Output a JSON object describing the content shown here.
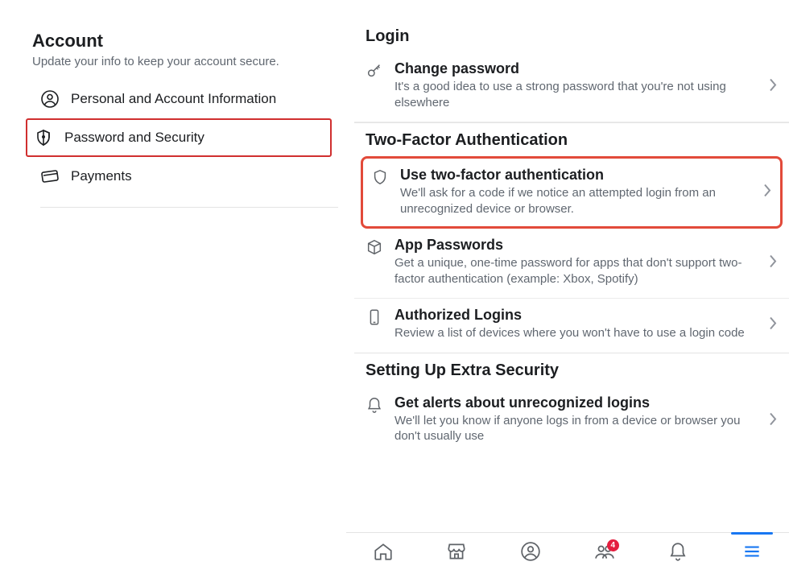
{
  "left": {
    "heading": "Account",
    "subtitle": "Update your info to keep your account secure.",
    "items": [
      {
        "label": "Personal and Account Information",
        "icon": "person-circle-icon",
        "highlight": false
      },
      {
        "label": "Password and Security",
        "icon": "shield-icon",
        "highlight": true
      },
      {
        "label": "Payments",
        "icon": "card-icon",
        "highlight": false
      }
    ]
  },
  "right": {
    "sections": [
      {
        "title": "Login",
        "items": [
          {
            "icon": "key-icon",
            "title": "Change password",
            "desc": "It's a good idea to use a strong password that you're not using elsewhere",
            "highlight": false
          }
        ]
      },
      {
        "title": "Two-Factor Authentication",
        "items": [
          {
            "icon": "shield-outline-icon",
            "title": "Use two-factor authentication",
            "desc": "We'll ask for a code if we notice an attempted login from an unrecognized device or browser.",
            "highlight": true
          },
          {
            "icon": "box-icon",
            "title": "App Passwords",
            "desc": "Get a unique, one-time password for apps that don't support two-factor authentication (example: Xbox, Spotify)",
            "highlight": false
          },
          {
            "icon": "phone-icon",
            "title": "Authorized Logins",
            "desc": "Review a list of devices where you won't have to use a login code",
            "highlight": false
          }
        ]
      },
      {
        "title": "Setting Up Extra Security",
        "items": [
          {
            "icon": "bell-icon",
            "title": "Get alerts about unrecognized logins",
            "desc": "We'll let you know if anyone logs in from a device or browser you don't usually use",
            "highlight": false
          }
        ]
      }
    ]
  },
  "tabbar": {
    "items": [
      {
        "name": "home-icon",
        "badge": null,
        "active": false
      },
      {
        "name": "marketplace-icon",
        "badge": null,
        "active": false
      },
      {
        "name": "profile-icon",
        "badge": null,
        "active": false
      },
      {
        "name": "groups-icon",
        "badge": "4",
        "active": false
      },
      {
        "name": "notifications-icon",
        "badge": null,
        "active": false
      },
      {
        "name": "menu-icon",
        "badge": null,
        "active": true
      }
    ]
  }
}
